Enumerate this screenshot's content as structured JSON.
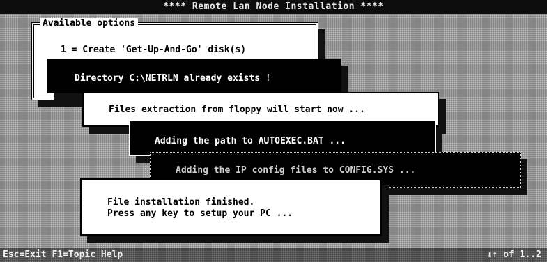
{
  "window": {
    "title": "**** Remote Lan Node Installation ****"
  },
  "options_panel": {
    "legend": "Available options",
    "item_1": "1 = Create 'Get-Up-And-Go' disk(s)"
  },
  "messages": {
    "directory_exists": "Directory C:\\NETRLN already exists !",
    "extraction": "Files extraction from floppy will start now ...",
    "adding_path": "Adding the path to AUTOEXEC.BAT ...",
    "adding_ip": "Adding the IP config files to CONFIG.SYS ...",
    "finished_line1": "File installation finished.",
    "finished_line2": "Press any key to setup your PC ..."
  },
  "status_bar": {
    "help_keys": "Esc=Exit  F1=Topic Help",
    "page_indicator": "↓↑ of 1..2"
  }
}
